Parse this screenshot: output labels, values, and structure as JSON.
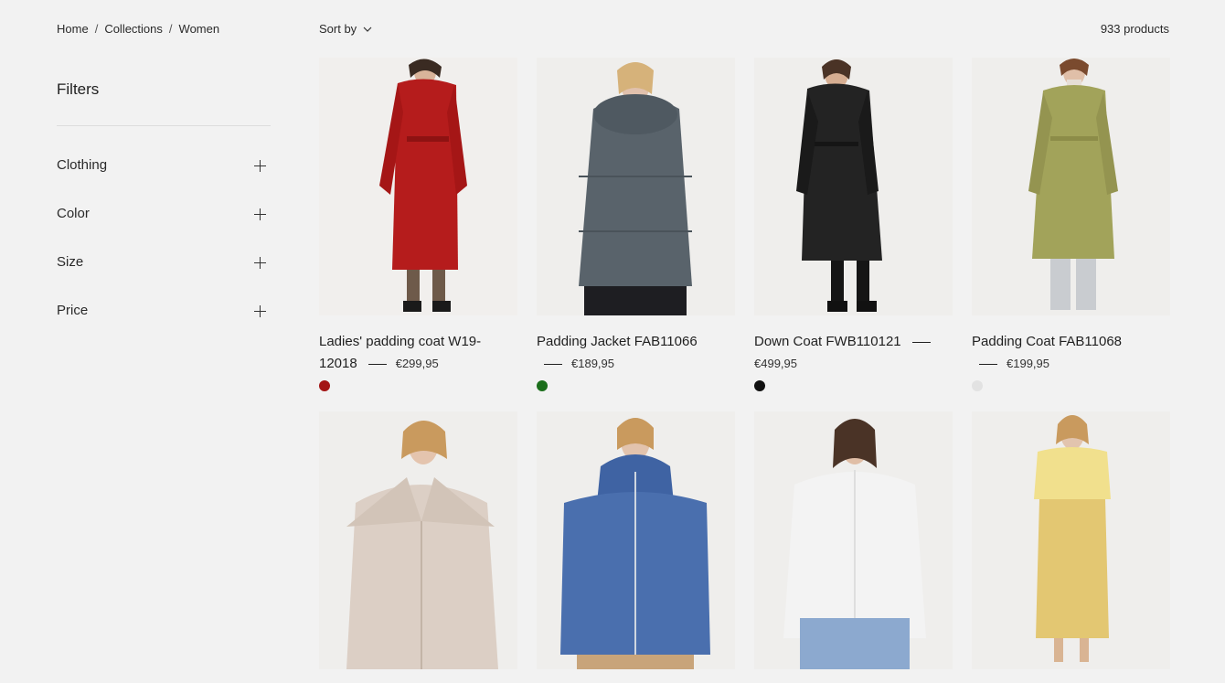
{
  "breadcrumb": {
    "home": "Home",
    "collections": "Collections",
    "women": "Women",
    "sep": "/"
  },
  "sort": {
    "label": "Sort by"
  },
  "product_count": "933 products",
  "filters": {
    "title": "Filters",
    "items": [
      {
        "label": "Clothing"
      },
      {
        "label": "Color"
      },
      {
        "label": "Size"
      },
      {
        "label": "Price"
      }
    ]
  },
  "products": [
    {
      "title": "Ladies' padding coat W19-12018",
      "price": "€299,95",
      "swatch": "#a31414",
      "garment": "#b51c1c"
    },
    {
      "title": "Padding Jacket FAB11066",
      "price": "€189,95",
      "swatch": "#1c6f1c",
      "garment": "#59636b"
    },
    {
      "title": "Down Coat FWB110121",
      "price": "€499,95",
      "swatch": "#111111",
      "garment": "#232323"
    },
    {
      "title": "Padding Coat FAB11068",
      "price": "€199,95",
      "swatch": "#e2e2e2",
      "garment": "#a2a35a"
    },
    {
      "title": "",
      "price": "",
      "swatch": "",
      "garment": "#dccfc5"
    },
    {
      "title": "",
      "price": "",
      "swatch": "",
      "garment": "#4a6fae"
    },
    {
      "title": "",
      "price": "",
      "swatch": "",
      "garment": "#f3f3f3"
    },
    {
      "title": "",
      "price": "",
      "swatch": "",
      "garment": "#e3c772"
    }
  ]
}
